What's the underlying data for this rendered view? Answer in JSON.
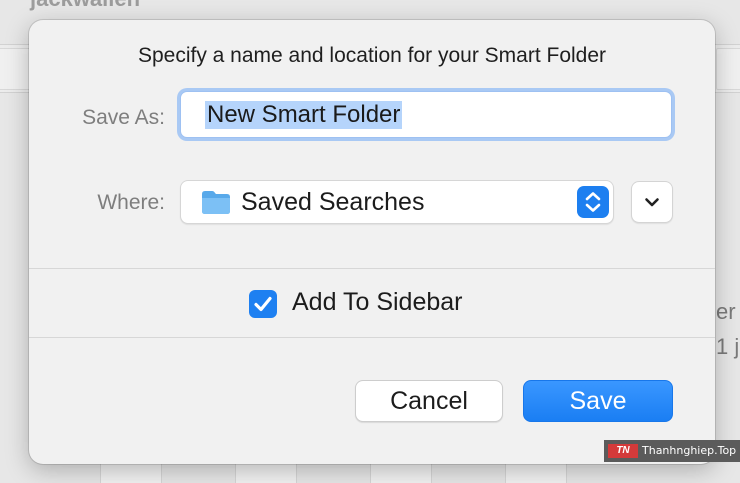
{
  "background": {
    "window_title": "jackwallen",
    "snippets": [
      "er",
      "1 j"
    ]
  },
  "dialog": {
    "title": "Specify a name and location for your Smart Folder",
    "save_as_label": "Save As:",
    "save_as_value": "New Smart Folder",
    "where_label": "Where:",
    "where_value": "Saved Searches",
    "where_icon": "folder-icon",
    "add_to_sidebar_label": "Add To Sidebar",
    "add_to_sidebar_checked": true,
    "cancel_label": "Cancel",
    "save_label": "Save"
  },
  "watermark": {
    "logo": "TN",
    "text": "Thanhnghiep.Top"
  },
  "colors": {
    "accent": "#1e80f1",
    "focus_ring": "#a9c9f4",
    "selection": "#b5d4fb"
  }
}
